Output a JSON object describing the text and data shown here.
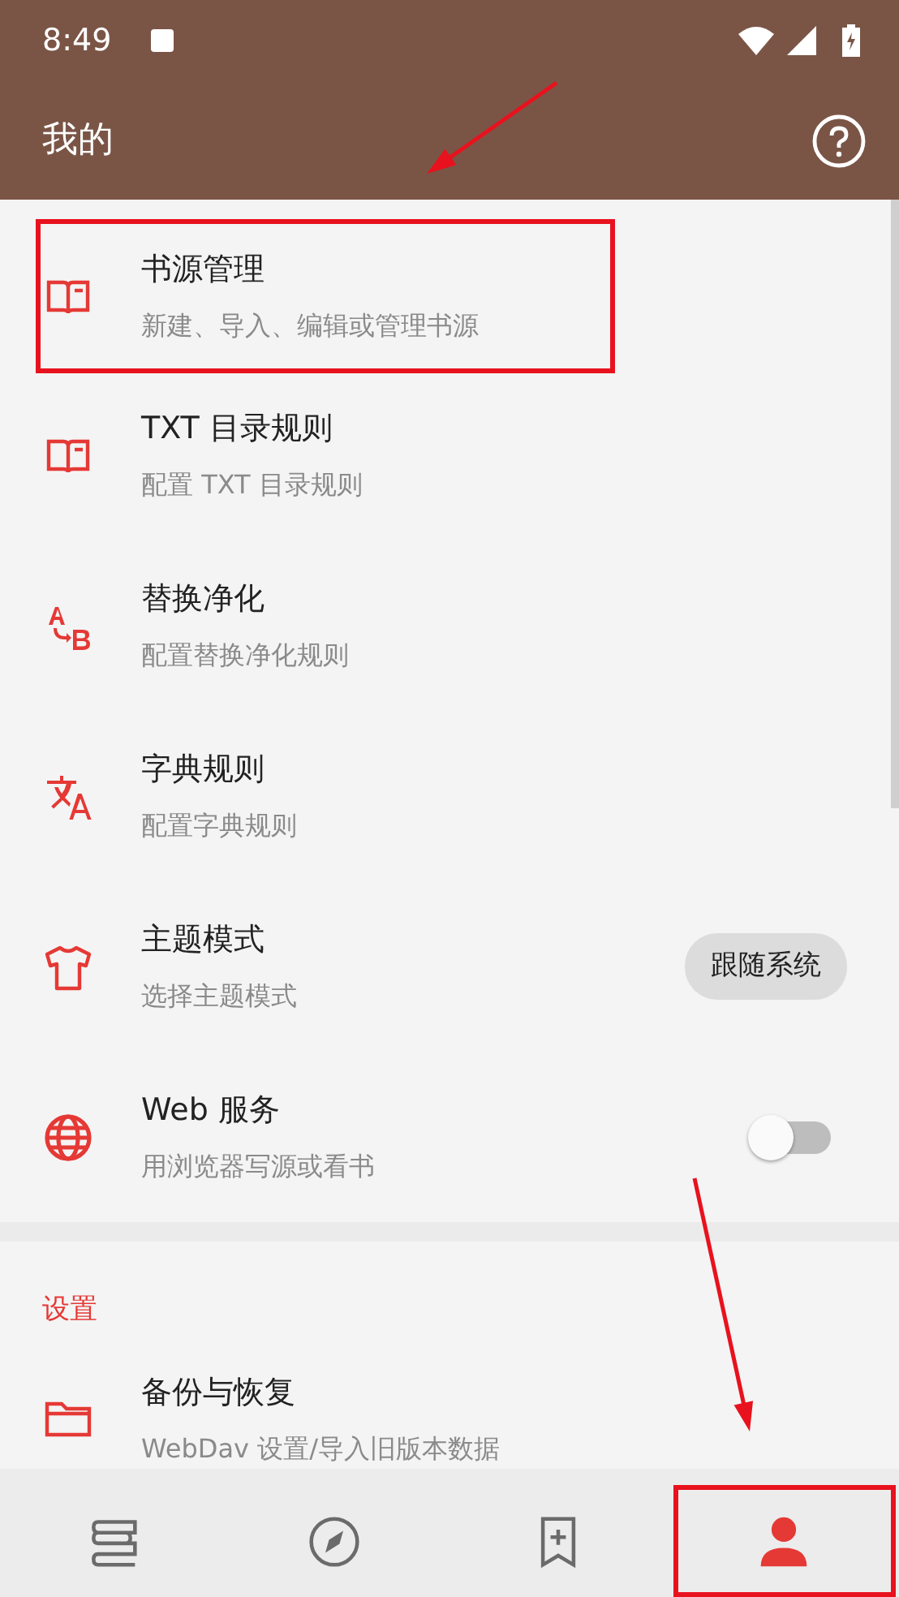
{
  "status_bar": {
    "time": "8:49"
  },
  "app_bar": {
    "title": "我的"
  },
  "items": [
    {
      "kind": "plain",
      "title": "书源管理",
      "subtitle": "新建、导入、编辑或管理书源",
      "highlighted": true
    },
    {
      "kind": "plain",
      "title": "TXT 目录规则",
      "subtitle": "配置 TXT 目录规则",
      "highlighted": false
    },
    {
      "kind": "plain",
      "title": "替换净化",
      "subtitle": "配置替换净化规则",
      "highlighted": false
    },
    {
      "kind": "plain",
      "title": "字典规则",
      "subtitle": "配置字典规则",
      "highlighted": false
    },
    {
      "kind": "chip",
      "title": "主题模式",
      "subtitle": "选择主题模式",
      "value": "跟随系统",
      "highlighted": false
    },
    {
      "kind": "switch",
      "title": "Web 服务",
      "subtitle": "用浏览器写源或看书",
      "on": false,
      "highlighted": false
    }
  ],
  "settings_section": {
    "header": "设置",
    "items": [
      {
        "title": "备份与恢复",
        "subtitle": "WebDav 设置/导入旧版本数据",
        "highlighted": false
      }
    ]
  },
  "bottom_nav": [
    {
      "selected": false,
      "highlighted": false
    },
    {
      "selected": false,
      "highlighted": false
    },
    {
      "selected": false,
      "highlighted": false
    },
    {
      "selected": true,
      "highlighted": true
    }
  ]
}
